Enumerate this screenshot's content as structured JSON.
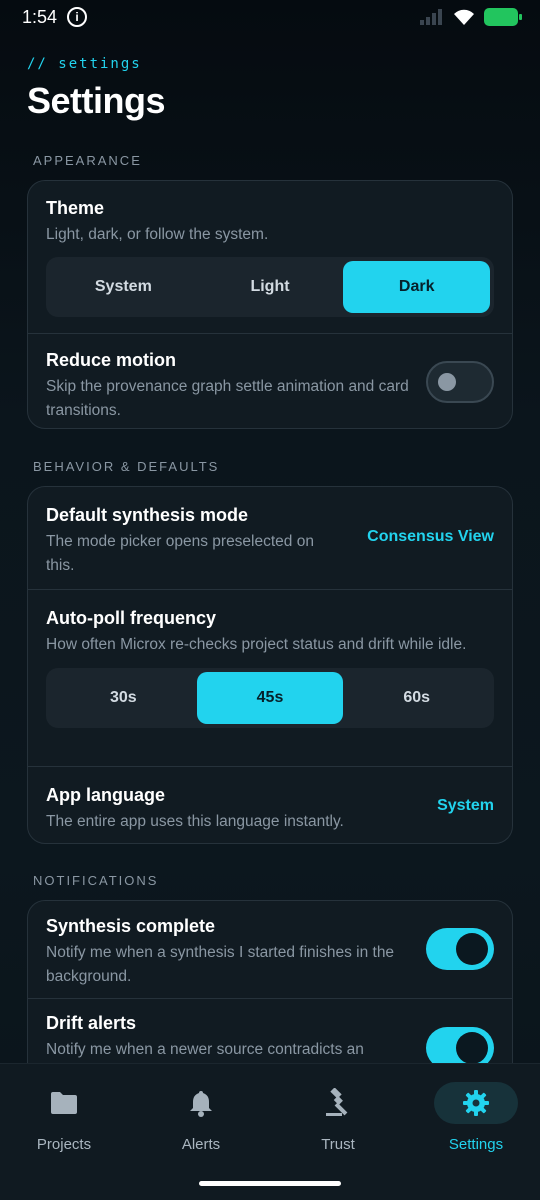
{
  "status_bar": {
    "time": "1:54"
  },
  "header": {
    "kicker": "// settings",
    "title": "Settings"
  },
  "appearance": {
    "label": "APPEARANCE",
    "theme": {
      "title": "Theme",
      "subtitle": "Light, dark, or follow the system.",
      "options": [
        "System",
        "Light",
        "Dark"
      ],
      "selected": "Dark"
    },
    "reduce_motion": {
      "title": "Reduce motion",
      "subtitle": "Skip the provenance graph settle animation and card transitions.",
      "enabled": false
    }
  },
  "behavior": {
    "label": "BEHAVIOR & DEFAULTS",
    "synthesis_mode": {
      "title": "Default synthesis mode",
      "subtitle": "The mode picker opens preselected on this.",
      "value": "Consensus View"
    },
    "auto_poll": {
      "title": "Auto-poll frequency",
      "subtitle": "How often Microx re-checks project status and drift while idle.",
      "options": [
        "30s",
        "45s",
        "60s"
      ],
      "selected": "45s"
    },
    "language": {
      "title": "App language",
      "subtitle": "The entire app uses this language instantly.",
      "value": "System"
    }
  },
  "notifications": {
    "label": "NOTIFICATIONS",
    "synthesis_complete": {
      "title": "Synthesis complete",
      "subtitle": "Notify me when a synthesis I started finishes in the background.",
      "enabled": true
    },
    "drift_alerts": {
      "title": "Drift alerts",
      "subtitle": "Notify me when a newer source contradicts an",
      "enabled": true
    }
  },
  "nav": {
    "items": [
      {
        "label": "Projects",
        "icon": "folder-icon"
      },
      {
        "label": "Alerts",
        "icon": "bell-icon"
      },
      {
        "label": "Trust",
        "icon": "gavel-icon"
      },
      {
        "label": "Settings",
        "icon": "gear-icon"
      }
    ],
    "active": "Settings"
  },
  "colors": {
    "accent": "#22d3ee",
    "background": "#0b151c",
    "card": "#111b22"
  }
}
